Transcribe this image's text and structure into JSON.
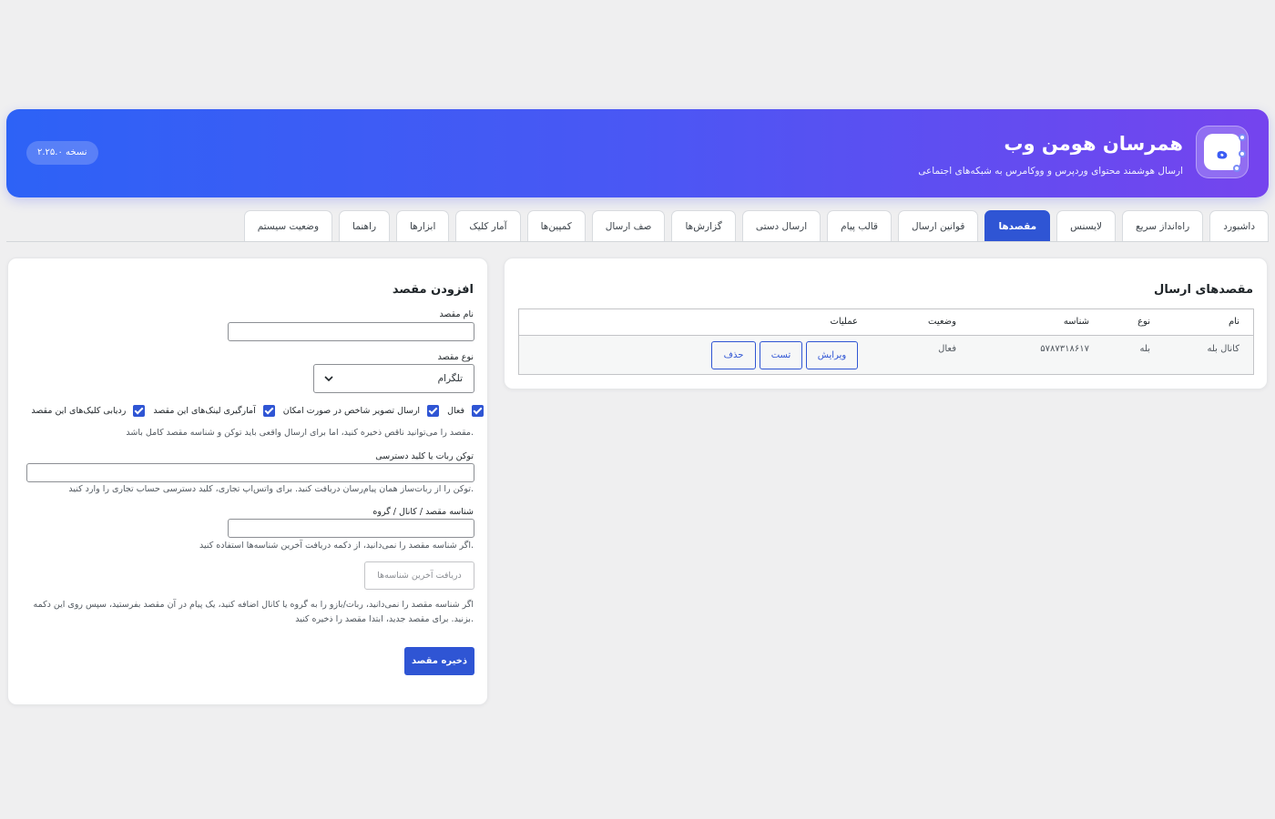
{
  "header": {
    "title": "همرسان هومن وب",
    "subtitle": "ارسال هوشمند محتوای وردپرس و ووکامرس به شبکه‌های اجتماعی",
    "version": "نسخه ۲.۲۵.۰",
    "logo_glyph": "ه",
    "accent_colors": [
      "#2d62f6",
      "#7544ee"
    ]
  },
  "tabs": [
    {
      "label": "داشبورد"
    },
    {
      "label": "راه‌انداز سریع"
    },
    {
      "label": "لایسنس"
    },
    {
      "label": "مقصدها",
      "active": true
    },
    {
      "label": "قوانین ارسال"
    },
    {
      "label": "قالب پیام"
    },
    {
      "label": "ارسال دستی"
    },
    {
      "label": "گزارش‌ها"
    },
    {
      "label": "صف ارسال"
    },
    {
      "label": "کمپین‌ها"
    },
    {
      "label": "آمار کلیک"
    },
    {
      "label": "ابزارها"
    },
    {
      "label": "راهنما"
    },
    {
      "label": "وضعیت سیستم"
    }
  ],
  "destinations": {
    "title": "مقصدهای ارسال",
    "columns": {
      "name": "نام",
      "type": "نوع",
      "id": "شناسه",
      "status": "وضعیت",
      "actions": "عملیات"
    },
    "rows": [
      {
        "name": "کانال بله",
        "type": "بله",
        "id": "۵۷۸۷۳۱۸۶۱۷",
        "status": "فعال",
        "edit": "ویرایش",
        "test": "تست",
        "delete": "حذف"
      }
    ]
  },
  "form": {
    "title": "افزودن مقصد",
    "name_label": "نام مقصد",
    "name_value": "",
    "type_label": "نوع مقصد",
    "type_value": "تلگرام",
    "checkboxes": [
      {
        "label": "فعال",
        "checked": true
      },
      {
        "label": "ارسال تصویر شاخص در صورت امکان",
        "checked": true
      },
      {
        "label": "آمارگیری لینک‌های این مقصد",
        "checked": true
      },
      {
        "label": "ردیابی کلیک‌های این مقصد",
        "checked": true
      }
    ],
    "note": "مقصد را می‌توانید ناقص ذخیره کنید، اما برای ارسال واقعی باید توکن و شناسه مقصد کامل باشد.",
    "token_label": "توکن ربات یا کلید دسترسی",
    "token_value": "",
    "token_hint": "توکن را از ربات‌ساز همان پیام‌رسان دریافت کنید. برای واتس‌اپ تجاری، کلید دسترسی حساب تجاری را وارد کنید.",
    "chat_label": "شناسه مقصد / کانال / گروه",
    "chat_value": "",
    "chat_hint": "اگر شناسه مقصد را نمی‌دانید، از دکمه دریافت آخرین شناسه‌ها استفاده کنید.",
    "fetch_button": "دریافت آخرین شناسه‌ها",
    "help_text": "اگر شناسه مقصد را نمی‌دانید، ربات/بازو را به گروه یا کانال اضافه کنید، یک پیام در آن مقصد بفرستید، سپس روی این دکمه بزنید. برای مقصد جدید، ابتدا مقصد را ذخیره کنید.",
    "save_button": "ذخیره مقصد"
  }
}
